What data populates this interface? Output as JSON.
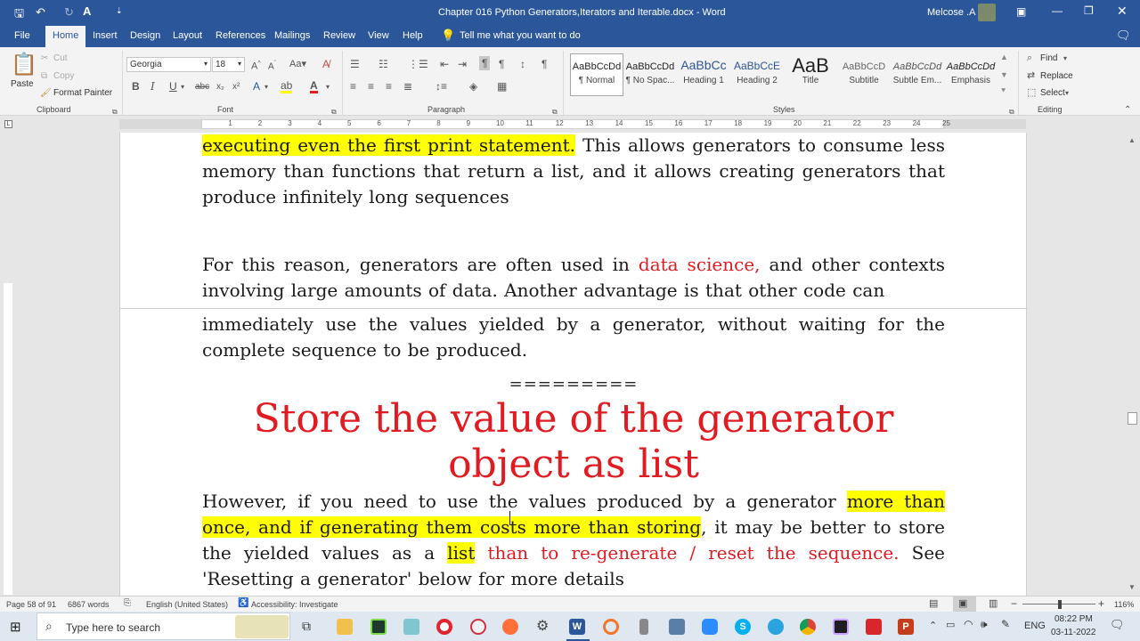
{
  "window": {
    "title": "Chapter 016 Python Generators,Iterators and Iterable.docx  -  Word",
    "user": "Melcose .A"
  },
  "tabs": [
    "File",
    "Home",
    "Insert",
    "Design",
    "Layout",
    "References",
    "Mailings",
    "Review",
    "View",
    "Help"
  ],
  "tell_me": "Tell me what you want to do",
  "ribbon": {
    "clipboard": {
      "paste": "Paste",
      "cut": "Cut",
      "copy": "Copy",
      "format_painter": "Format Painter",
      "label": "Clipboard"
    },
    "font": {
      "name": "Georgia",
      "size": "18",
      "label": "Font"
    },
    "paragraph": {
      "label": "Paragraph"
    },
    "styles": {
      "label": "Styles",
      "items": [
        {
          "preview": "AaBbCcDd",
          "name": "¶ Normal"
        },
        {
          "preview": "AaBbCcDd",
          "name": "¶ No Spac..."
        },
        {
          "preview": "AaBbCc",
          "name": "Heading 1"
        },
        {
          "preview": "AaBbCcE",
          "name": "Heading 2"
        },
        {
          "preview": "AaB",
          "name": "Title"
        },
        {
          "preview": "AaBbCcD",
          "name": "Subtitle"
        },
        {
          "preview": "AaBbCcDd",
          "name": "Subtle Em..."
        },
        {
          "preview": "AaBbCcDd",
          "name": "Emphasis"
        }
      ]
    },
    "editing": {
      "find": "Find",
      "replace": "Replace",
      "select": "Select",
      "label": "Editing"
    }
  },
  "ruler": {
    "numbers": [
      "1",
      "2",
      "3",
      "4",
      "5",
      "6",
      "7",
      "8",
      "9",
      "10",
      "11",
      "12",
      "13",
      "14",
      "15",
      "16",
      "17",
      "18",
      "19",
      "20",
      "21",
      "22",
      "23",
      "24",
      "25"
    ]
  },
  "document": {
    "p1": {
      "hl": "executing even the first print statement.",
      "rest": " This allows generators to consume less memory than functions that return a list, and it allows creating generators that produce infinitely long sequences"
    },
    "p2": {
      "a": "For this reason, generators are often used in ",
      "red": "data science,",
      "b": " and other contexts involving large amounts of data. Another advantage is that other code can"
    },
    "p3": "immediately use the values yielded by a generator, without waiting for the complete sequence to be produced.",
    "separator": "=========",
    "heading": "Store the value of the generator object as list",
    "p4": {
      "a": "However, if you need to use the values produced by a generator ",
      "hl1": "more than once, and if generating them costs more than storing",
      "b": ", it may be better to store the yielded values as a ",
      "hl2": "list",
      "red": " than to re-generate / reset the sequence.",
      "c": " See 'Resetting a generator' below for more details"
    }
  },
  "status": {
    "page": "Page 58 of 91",
    "words": "6867 words",
    "language": "English (United States)",
    "accessibility": "Accessibility: Investigate",
    "zoom": "116%"
  },
  "taskbar": {
    "search_placeholder": "Type here to search",
    "lang": "ENG",
    "time": "08:22 PM",
    "date": "03-11-2022"
  }
}
